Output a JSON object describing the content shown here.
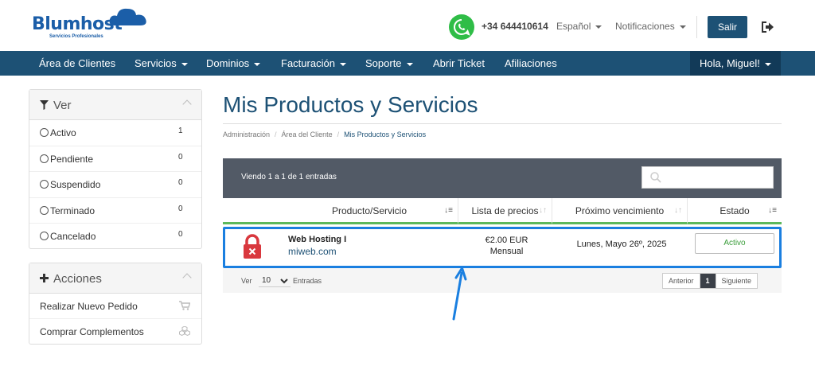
{
  "header": {
    "logo_text": "Blumhost",
    "logo_sub": "Servicios Profesionales",
    "phone": "+34 644410614",
    "language": "Español",
    "notifications": "Notificaciones",
    "logout_label": "Salir"
  },
  "nav": {
    "items": [
      {
        "label": "Área de Clientes",
        "dropdown": false
      },
      {
        "label": "Servicios",
        "dropdown": true
      },
      {
        "label": "Dominios",
        "dropdown": true
      },
      {
        "label": "Facturación",
        "dropdown": true
      },
      {
        "label": "Soporte",
        "dropdown": true
      },
      {
        "label": "Abrir Ticket",
        "dropdown": false
      },
      {
        "label": "Afiliaciones",
        "dropdown": false
      }
    ],
    "user": "Hola, Miguel!"
  },
  "sidebar": {
    "filter_title": "Ver",
    "filters": [
      {
        "label": "Activo",
        "count": "1"
      },
      {
        "label": "Pendiente",
        "count": "0"
      },
      {
        "label": "Suspendido",
        "count": "0"
      },
      {
        "label": "Terminado",
        "count": "0"
      },
      {
        "label": "Cancelado",
        "count": "0"
      }
    ],
    "actions_title": "Acciones",
    "actions": [
      {
        "label": "Realizar Nuevo Pedido",
        "icon": "cart-icon"
      },
      {
        "label": "Comprar Complementos",
        "icon": "cubes-icon"
      }
    ]
  },
  "main": {
    "title": "Mis Productos y Servicios",
    "breadcrumb": [
      "Administración",
      "Área del Cliente",
      "Mis Productos y Servicios"
    ],
    "showing": "Viendo 1 a 1 de 1 entradas",
    "search_placeholder": "",
    "columns": [
      "Producto/Servicio",
      "Lista de precios",
      "Próximo vencimiento",
      "Estado"
    ],
    "rows": [
      {
        "product": "Web Hosting I",
        "domain": "miweb.com",
        "price": "€2.00 EUR",
        "cycle": "Mensual",
        "due": "Lunes, Mayo 26º, 2025",
        "status": "Activo"
      }
    ],
    "footer": {
      "ver": "Ver",
      "per_page": "10",
      "entradas": "Entradas",
      "prev": "Anterior",
      "page": "1",
      "next": "Siguiente"
    }
  },
  "colors": {
    "primary": "#1d5175",
    "accent_green": "#5cb85c",
    "highlight_blue": "#1a7fe0",
    "whatsapp": "#2fbd47"
  }
}
